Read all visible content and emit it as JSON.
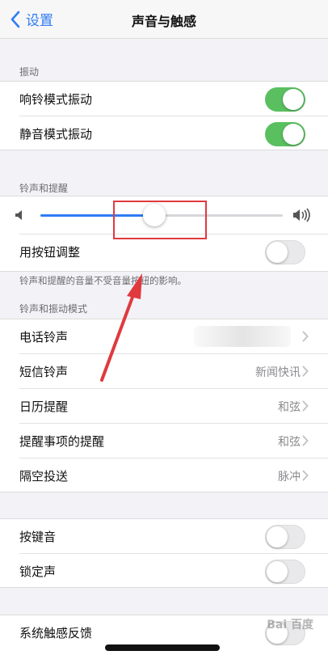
{
  "nav": {
    "back_label": "设置",
    "title": "声音与触感"
  },
  "sections": {
    "vibration": {
      "header": "振动",
      "rows": [
        {
          "label": "响铃模式振动",
          "on": true
        },
        {
          "label": "静音模式振动",
          "on": true
        }
      ]
    },
    "ringer": {
      "header": "铃声和提醒",
      "slider_level": 0.47,
      "button_adjust": {
        "label": "用按钮调整",
        "on": false
      },
      "note": "铃声和提醒的音量不受音量按钮的影响。"
    },
    "patterns": {
      "header": "铃声和振动模式",
      "rows": [
        {
          "label": "电话铃声",
          "value": ""
        },
        {
          "label": "短信铃声",
          "value": "新闻快讯"
        },
        {
          "label": "日历提醒",
          "value": "和弦"
        },
        {
          "label": "提醒事项的提醒",
          "value": "和弦"
        },
        {
          "label": "隔空投送",
          "value": "脉冲"
        }
      ]
    },
    "clicks": {
      "rows": [
        {
          "label": "按键音",
          "on": false
        },
        {
          "label": "锁定声",
          "on": false
        }
      ]
    },
    "haptics": {
      "rows": [
        {
          "label": "系统触感反馈",
          "on": false
        }
      ]
    }
  },
  "colors": {
    "accent": "#2f7cf6",
    "toggle_on": "#5ac05f",
    "annotation": "#e0393e"
  },
  "watermark": "Bai 百度"
}
